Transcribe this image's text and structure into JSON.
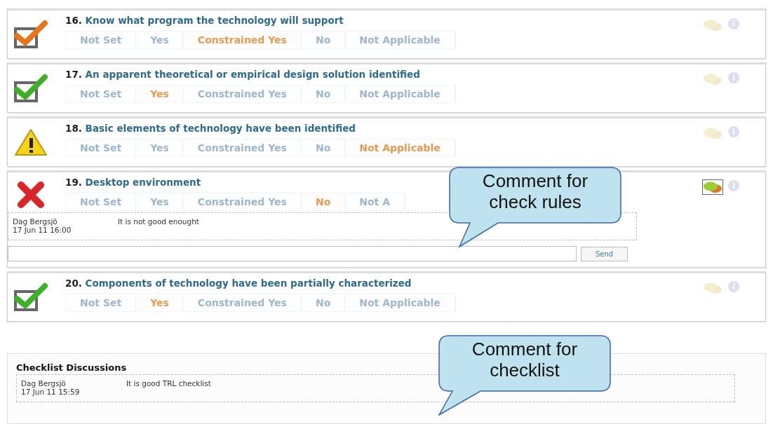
{
  "items": [
    {
      "number": "16.",
      "title": "Know what program the technology will support",
      "kind": "partial",
      "has_comments": false,
      "options": [
        {
          "label": "Not Set",
          "selected": false
        },
        {
          "label": "Yes",
          "selected": false
        },
        {
          "label": "Constrained Yes",
          "selected": true
        },
        {
          "label": "No",
          "selected": false
        },
        {
          "label": "Not Applicable",
          "selected": false
        }
      ]
    },
    {
      "number": "17.",
      "title": "An apparent theoretical or empirical design solution identified",
      "kind": "done",
      "has_comments": false,
      "options": [
        {
          "label": "Not Set",
          "selected": false
        },
        {
          "label": "Yes",
          "selected": true
        },
        {
          "label": "Constrained Yes",
          "selected": false
        },
        {
          "label": "No",
          "selected": false
        },
        {
          "label": "Not Applicable",
          "selected": false
        }
      ]
    },
    {
      "number": "18.",
      "title": "Basic elements of technology have been identified",
      "kind": "warning",
      "has_comments": false,
      "options": [
        {
          "label": "Not Set",
          "selected": false
        },
        {
          "label": "Yes",
          "selected": false
        },
        {
          "label": "Constrained Yes",
          "selected": false
        },
        {
          "label": "No",
          "selected": false
        },
        {
          "label": "Not Applicable",
          "selected": true
        }
      ]
    },
    {
      "number": "19.",
      "title": "Desktop environment",
      "kind": "failed",
      "has_comments": true,
      "options": [
        {
          "label": "Not Set",
          "selected": false
        },
        {
          "label": "Yes",
          "selected": false
        },
        {
          "label": "Constrained Yes",
          "selected": false
        },
        {
          "label": "No",
          "selected": true
        },
        {
          "label": "Not A",
          "selected": false
        }
      ],
      "comments": [
        {
          "author": "Dag Bergsjö",
          "date": "17 Jun 11 16:00",
          "text": "It is not good enought"
        }
      ],
      "send_button": "Send"
    },
    {
      "number": "20.",
      "title": "Components of technology have been partially characterized",
      "kind": "done",
      "has_comments": false,
      "options": [
        {
          "label": "Not Set",
          "selected": false
        },
        {
          "label": "Yes",
          "selected": true
        },
        {
          "label": "Constrained Yes",
          "selected": false
        },
        {
          "label": "No",
          "selected": false
        },
        {
          "label": "Not Applicable",
          "selected": false
        }
      ]
    }
  ],
  "discussion": {
    "title": "Checklist Discussions",
    "comments": [
      {
        "author": "Dag Bergsjö",
        "date": "17 Jun 11 15:59",
        "text": "It is good TRL checklist"
      }
    ]
  },
  "callouts": [
    {
      "lines": [
        "Comment for",
        "check rules"
      ]
    },
    {
      "lines": [
        "Comment for",
        "checklist"
      ]
    }
  ]
}
